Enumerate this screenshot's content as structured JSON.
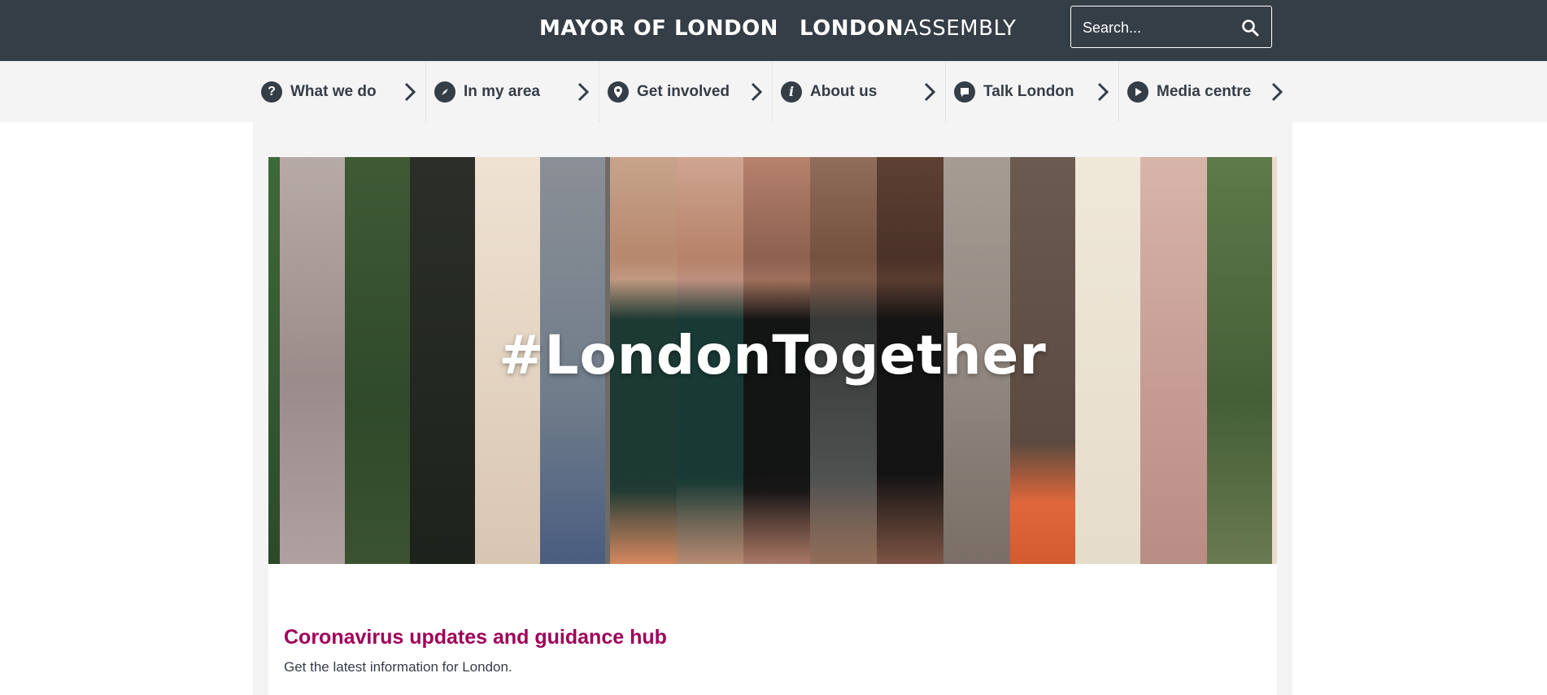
{
  "header": {
    "brand_mayor": "MAYOR OF LONDON",
    "brand_assembly_bold": "LONDON",
    "brand_assembly_light": "ASSEMBLY",
    "search_placeholder": "Search..."
  },
  "nav": {
    "items": [
      {
        "label": "What we do",
        "icon": "question-icon"
      },
      {
        "label": "In my area",
        "icon": "compass-icon"
      },
      {
        "label": "Get involved",
        "icon": "map-pin-icon"
      },
      {
        "label": "About us",
        "icon": "info-icon"
      },
      {
        "label": "Talk London",
        "icon": "speech-bubble-icon"
      },
      {
        "label": "Media centre",
        "icon": "play-icon"
      }
    ]
  },
  "hero": {
    "text": "#LondonTogether"
  },
  "card": {
    "title": "Coronavirus updates and guidance hub",
    "subtitle": "Get the latest information for London."
  },
  "colors": {
    "header_bg": "#353d47",
    "nav_bg": "#f4f4f4",
    "title_accent": "#9e0059"
  }
}
